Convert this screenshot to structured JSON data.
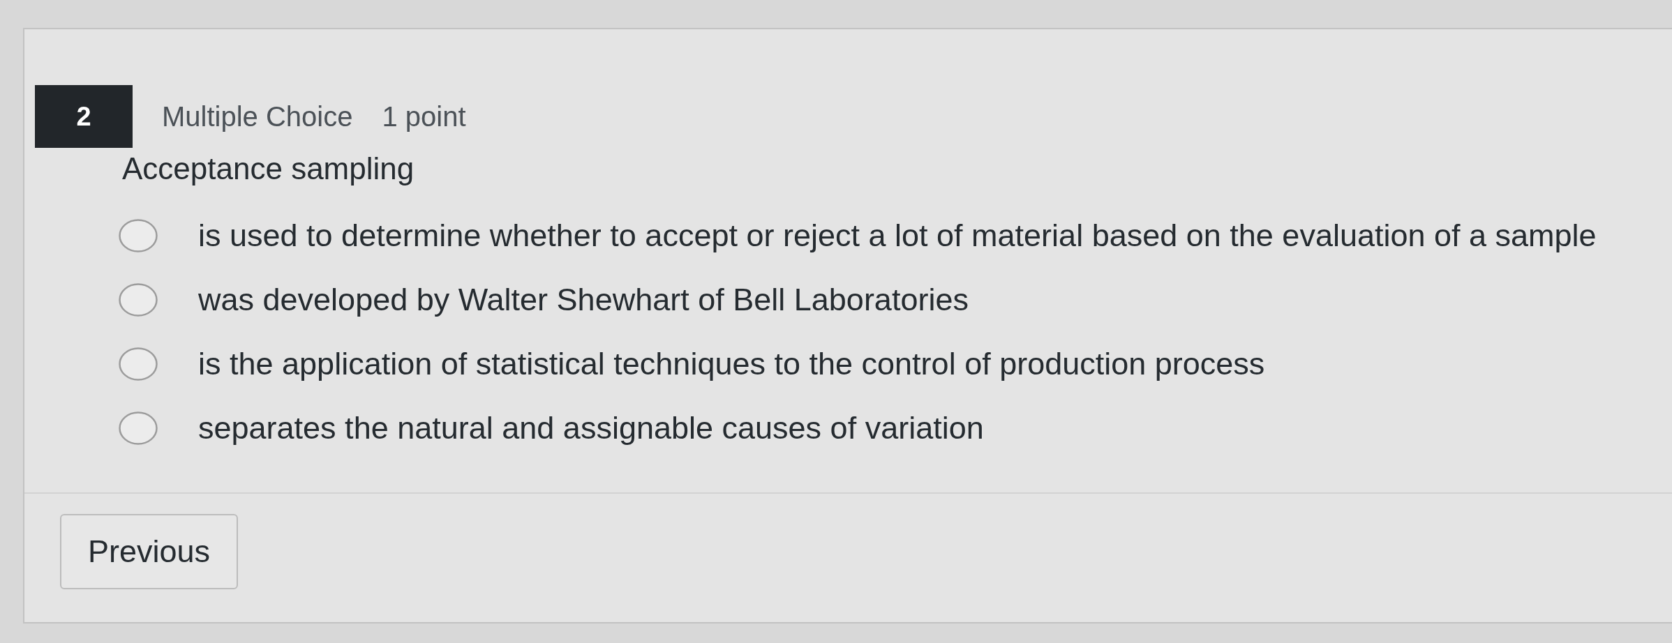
{
  "question": {
    "number": "2",
    "type": "Multiple Choice",
    "points": "1 point",
    "prompt": "Acceptance sampling",
    "options": [
      {
        "label": "is used to determine whether to accept or reject a lot of material based on the evaluation of a sample",
        "selected": false
      },
      {
        "label": "was developed by Walter Shewhart of Bell Laboratories",
        "selected": false
      },
      {
        "label": "is the application of statistical techniques to the control of production process",
        "selected": false
      },
      {
        "label": "separates the natural and assignable causes of variation",
        "selected": false
      }
    ]
  },
  "navigation": {
    "previous": "Previous"
  }
}
